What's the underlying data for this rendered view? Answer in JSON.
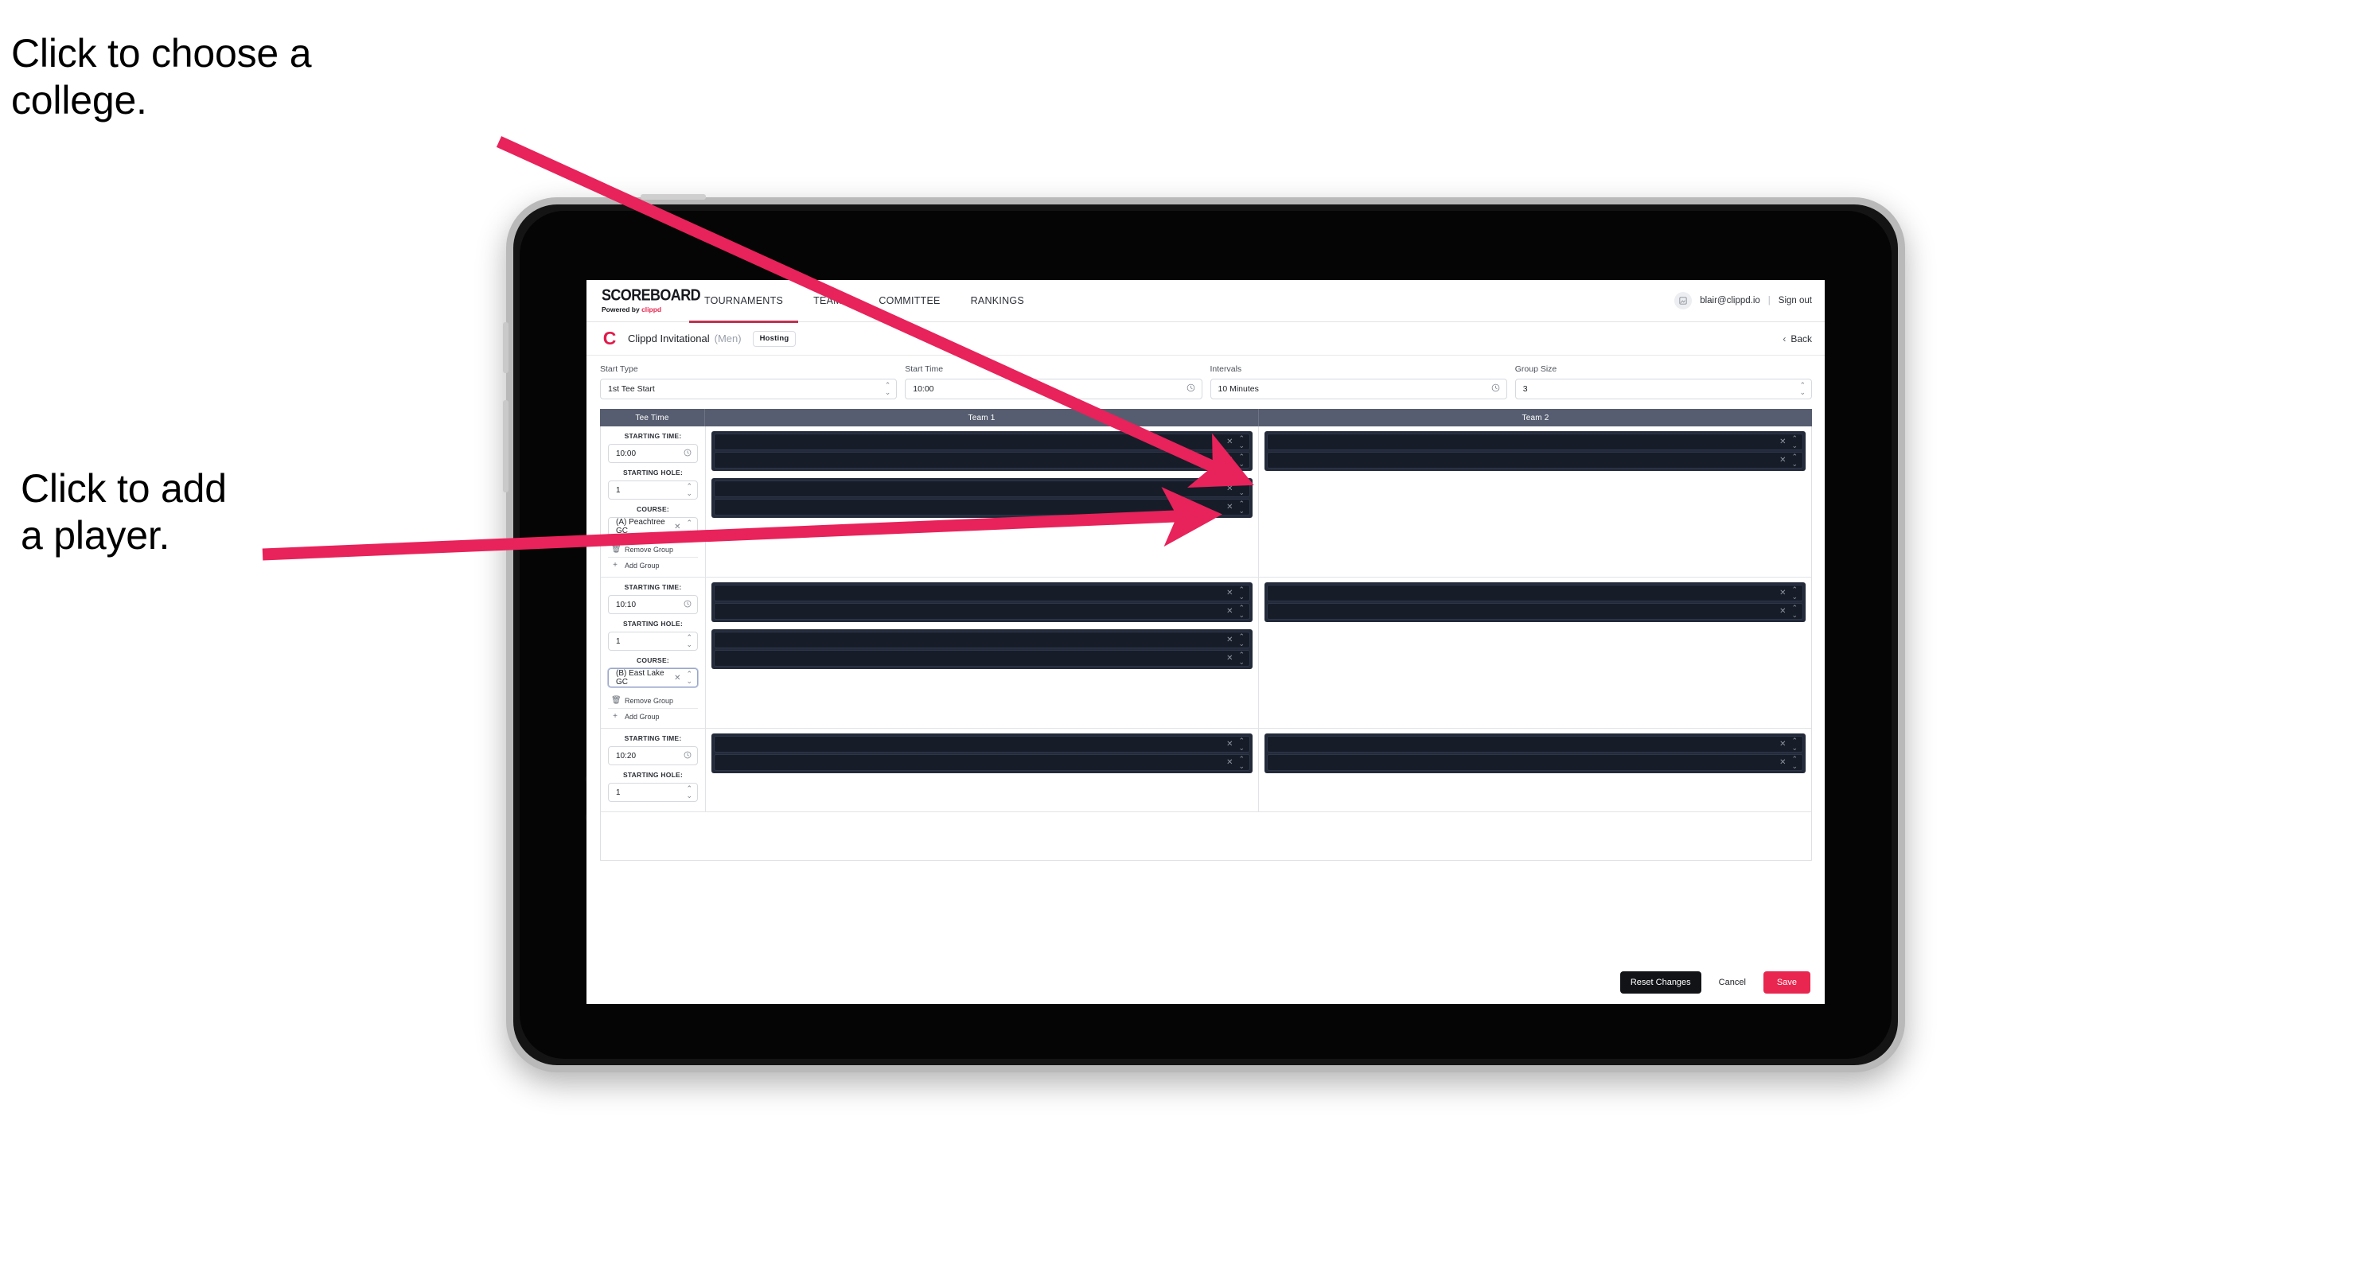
{
  "annotations": {
    "choose_college": "Click to choose a\ncollege.",
    "add_player": "Click to add\na player."
  },
  "colors": {
    "accent_pink": "#e8264f",
    "arrow_pink": "#e8225a",
    "nav_active_underline": "#c0314f",
    "table_header_bg": "#565d70",
    "player_block_bg": "#232a3a",
    "player_row_bg": "#161c28",
    "reset_button_bg": "#111317"
  },
  "topnav": {
    "brand_main": "SCOREBOARD",
    "brand_sub_prefix": "Powered by ",
    "brand_sub_name": "clippd",
    "tabs": [
      {
        "label": "TOURNAMENTS",
        "active": true
      },
      {
        "label": "TEAMS",
        "active": false
      },
      {
        "label": "COMMITTEE",
        "active": false
      },
      {
        "label": "RANKINGS",
        "active": false
      }
    ],
    "avatar_icon": "user-avatar-icon",
    "user_email": "blair@clippd.io",
    "separator": "|",
    "sign_out": "Sign out"
  },
  "tournament_bar": {
    "logo_letter": "C",
    "name": "Clippd Invitational",
    "gender": "(Men)",
    "badge": "Hosting",
    "back_chevron": "‹",
    "back_label": "Back"
  },
  "controls": [
    {
      "label": "Start Type",
      "value": "1st Tee Start",
      "icon": "stepper-icon"
    },
    {
      "label": "Start Time",
      "value": "10:00",
      "icon": "clock-icon"
    },
    {
      "label": "Intervals",
      "value": "10 Minutes",
      "icon": "clock-icon"
    },
    {
      "label": "Group Size",
      "value": "3",
      "icon": "stepper-icon"
    }
  ],
  "table": {
    "headers": [
      "Tee Time",
      "Team 1",
      "Team 2"
    ],
    "field_labels": {
      "starting_time": "STARTING TIME:",
      "starting_hole": "STARTING HOLE:",
      "course": "COURSE:"
    },
    "group_actions": {
      "remove": "Remove Group",
      "remove_icon": "trash-icon",
      "add": "Add Group",
      "add_icon": "plus-icon"
    },
    "icons": {
      "clock": "clock-icon",
      "stepper": "stepper-icon",
      "clear": "clear-x-icon"
    },
    "rows": [
      {
        "starting_time": "10:00",
        "starting_hole": "1",
        "course": "(A) Peachtree GC",
        "course_focused": false,
        "team1_blocks": [
          2,
          2
        ],
        "team2_blocks": [
          2
        ]
      },
      {
        "starting_time": "10:10",
        "starting_hole": "1",
        "course": "(B) East Lake GC",
        "course_focused": true,
        "team1_blocks": [
          2,
          2
        ],
        "team2_blocks": [
          2
        ]
      },
      {
        "starting_time": "10:20",
        "starting_hole": "1",
        "course": "",
        "course_focused": false,
        "team1_blocks": [
          2
        ],
        "team2_blocks": [
          2
        ]
      }
    ]
  },
  "footer": {
    "reset": "Reset Changes",
    "cancel": "Cancel",
    "save": "Save"
  }
}
